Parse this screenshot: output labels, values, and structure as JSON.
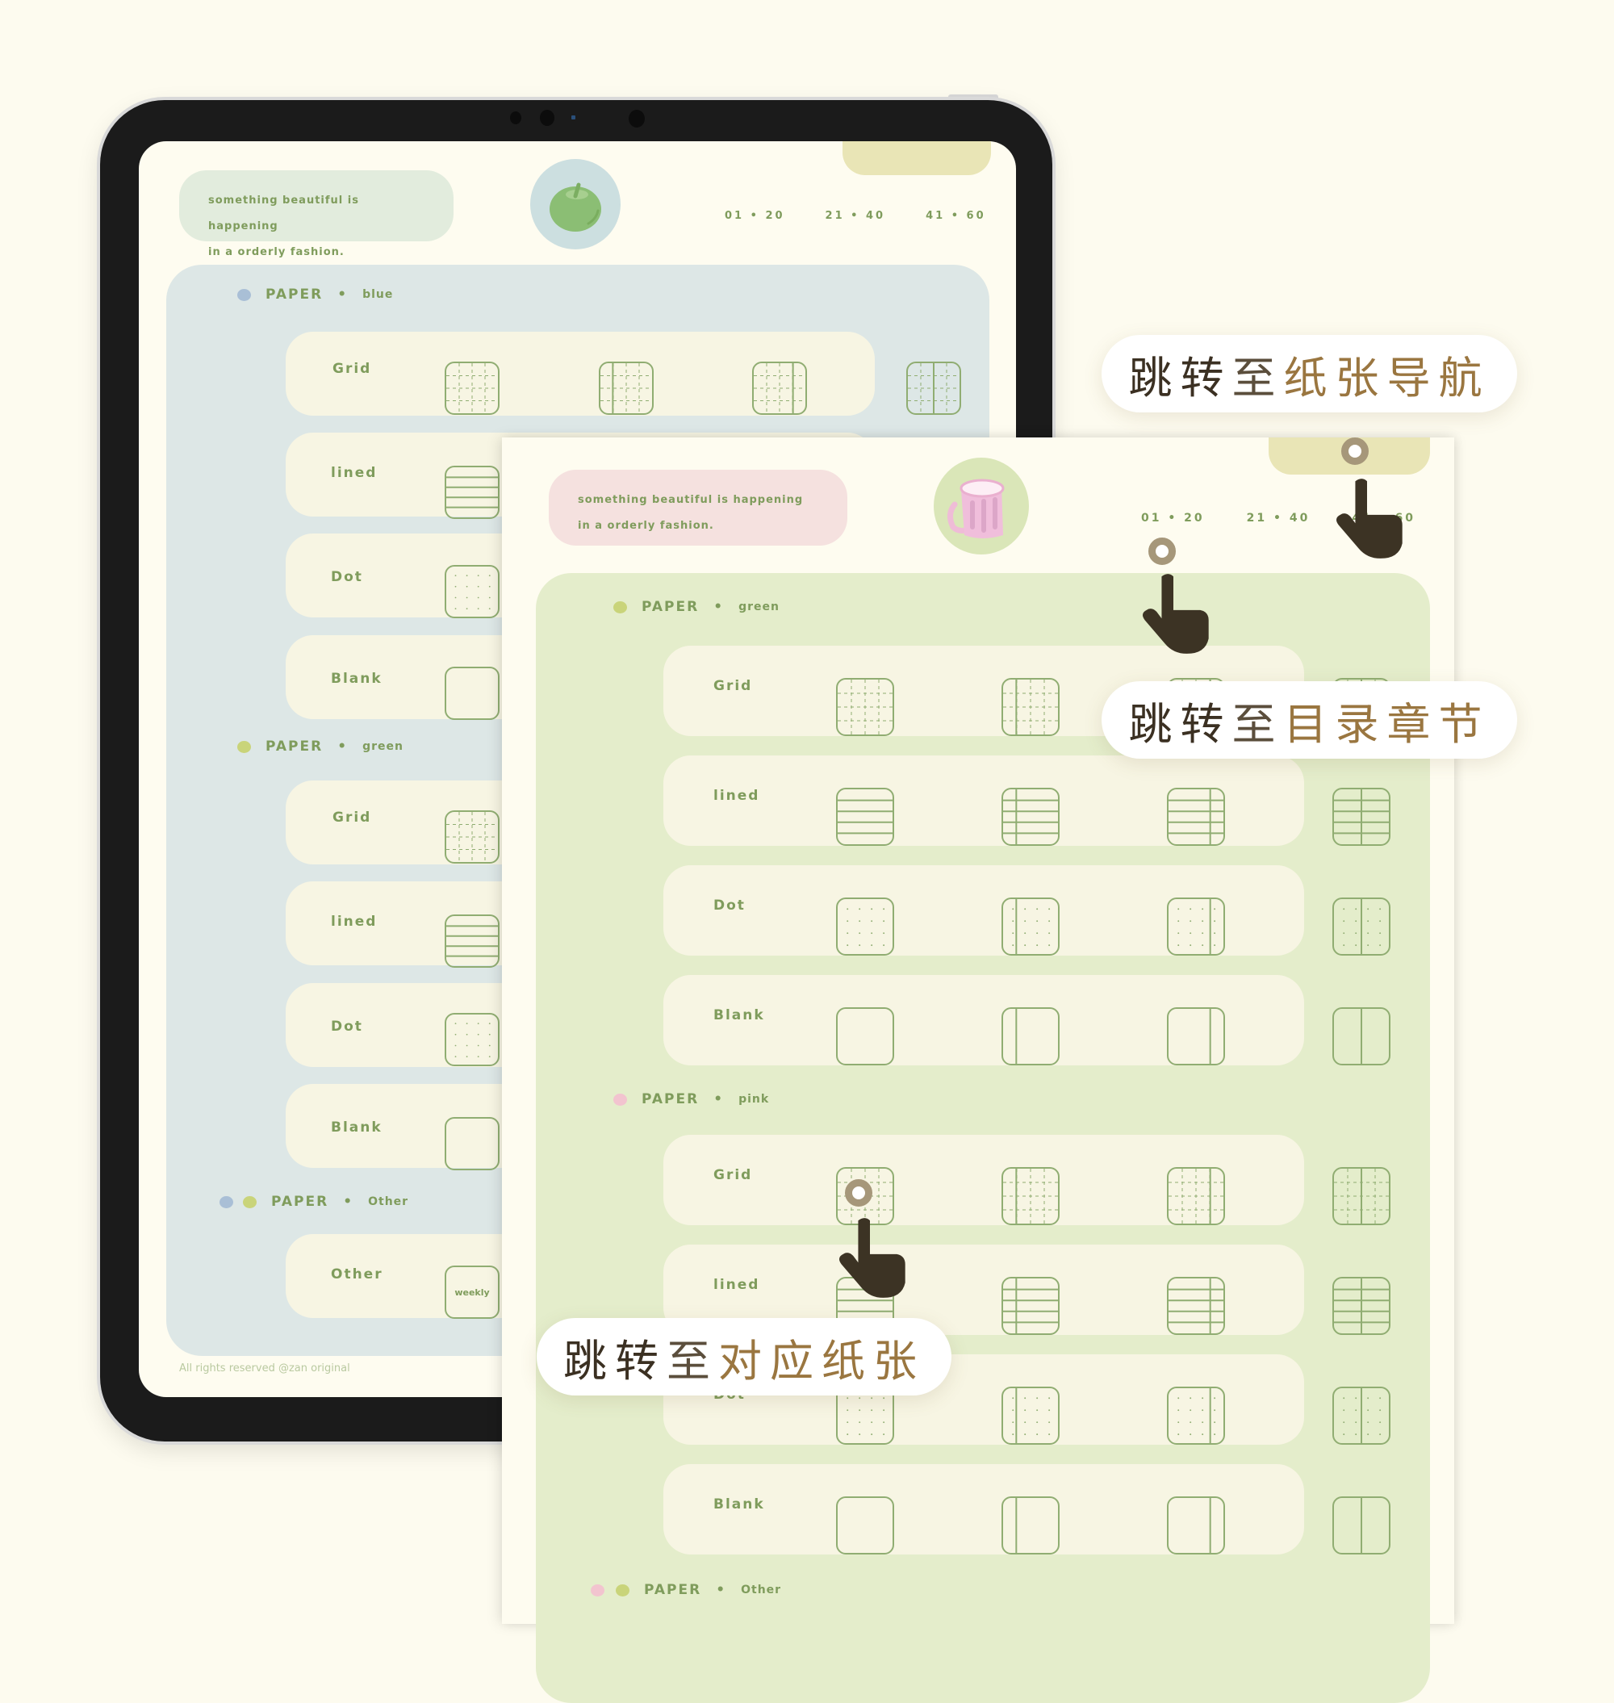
{
  "back_device": {
    "quote": [
      "something beautiful is happening",
      "in a orderly fashion."
    ],
    "mascot_icon": "green-apple-icon",
    "nav_ranges": [
      "01 • 20",
      "21 • 40",
      "41 • 60"
    ],
    "sections": [
      {
        "title": "PAPER",
        "subtitle": "blue",
        "dot_colors": [
          "#a9bfd6"
        ],
        "rows": [
          {
            "label": "Grid",
            "thumbs": [
              "grid",
              "grid-left",
              "grid-right",
              "grid-split"
            ]
          },
          {
            "label": "lined",
            "thumbs": [
              "lined"
            ]
          },
          {
            "label": "Dot",
            "thumbs": [
              "dot"
            ]
          },
          {
            "label": "Blank",
            "thumbs": [
              "blank"
            ]
          }
        ]
      },
      {
        "title": "PAPER",
        "subtitle": "green",
        "dot_colors": [
          "#c9d47a"
        ],
        "rows": [
          {
            "label": "Grid",
            "thumbs": [
              "grid"
            ]
          },
          {
            "label": "lined",
            "thumbs": [
              "lined"
            ]
          },
          {
            "label": "Dot",
            "thumbs": [
              "dot"
            ]
          },
          {
            "label": "Blank",
            "thumbs": [
              "blank"
            ]
          }
        ]
      },
      {
        "title": "PAPER",
        "subtitle": "Other",
        "dot_colors": [
          "#a9bfd6",
          "#c9d47a"
        ],
        "rows": [
          {
            "label": "Other",
            "thumbs": [
              "weekly"
            ],
            "thumb_text": "weekly"
          }
        ]
      }
    ],
    "footer": "All rights reserved @zan original"
  },
  "front_page": {
    "quote": [
      "something beautiful is happening",
      "in a orderly fashion."
    ],
    "mascot_icon": "pink-mug-icon",
    "nav_ranges": [
      "01 • 20",
      "21 • 40",
      "41 • 60"
    ],
    "sections": [
      {
        "title": "PAPER",
        "subtitle": "green",
        "dot_colors": [
          "#c9d47a"
        ],
        "rows": [
          {
            "label": "Grid",
            "thumbs": [
              "grid",
              "grid-left",
              "grid-right",
              "grid-split"
            ]
          },
          {
            "label": "lined",
            "thumbs": [
              "lined",
              "lined-left",
              "lined-right",
              "lined-split"
            ]
          },
          {
            "label": "Dot",
            "thumbs": [
              "dot",
              "dot-left",
              "dot-right",
              "dot-split"
            ]
          },
          {
            "label": "Blank",
            "thumbs": [
              "blank",
              "blank-left",
              "blank-right",
              "blank-split"
            ]
          }
        ]
      },
      {
        "title": "PAPER",
        "subtitle": "pink",
        "dot_colors": [
          "#f2c4cf"
        ],
        "rows": [
          {
            "label": "Grid",
            "thumbs": [
              "grid",
              "grid-left",
              "grid-right",
              "grid-split"
            ]
          },
          {
            "label": "lined",
            "thumbs": [
              "lined",
              "lined-left",
              "lined-right",
              "lined-split"
            ]
          },
          {
            "label": "Dot",
            "thumbs": [
              "dot",
              "dot-left",
              "dot-right",
              "dot-split"
            ]
          },
          {
            "label": "Blank",
            "thumbs": [
              "blank",
              "blank-left",
              "blank-right",
              "blank-split"
            ]
          }
        ]
      },
      {
        "title": "PAPER",
        "subtitle": "Other",
        "dot_colors": [
          "#f2c4cf",
          "#c9d47a"
        ],
        "rows": []
      }
    ]
  },
  "callouts": [
    {
      "prefix": "跳转",
      "mid": "至",
      "highlight": "纸张导航"
    },
    {
      "prefix": "跳转",
      "mid": "至",
      "highlight": "目录章节"
    },
    {
      "prefix": "跳转",
      "mid": "至",
      "highlight": "对应纸张"
    }
  ],
  "colors": {
    "text_green": "#7f9c5c",
    "panel_blue": "#dde7e6",
    "panel_green": "#e4edcb",
    "quote_green": "#e2ecdd",
    "quote_pink": "#f5e1df",
    "nav_tab": "#e9e5b6",
    "row_bg": "#f7f5e3",
    "callout_dark": "#3b3022",
    "callout_brown": "#9a7640",
    "hand": "#3c3324",
    "ring": "#a6977a"
  }
}
